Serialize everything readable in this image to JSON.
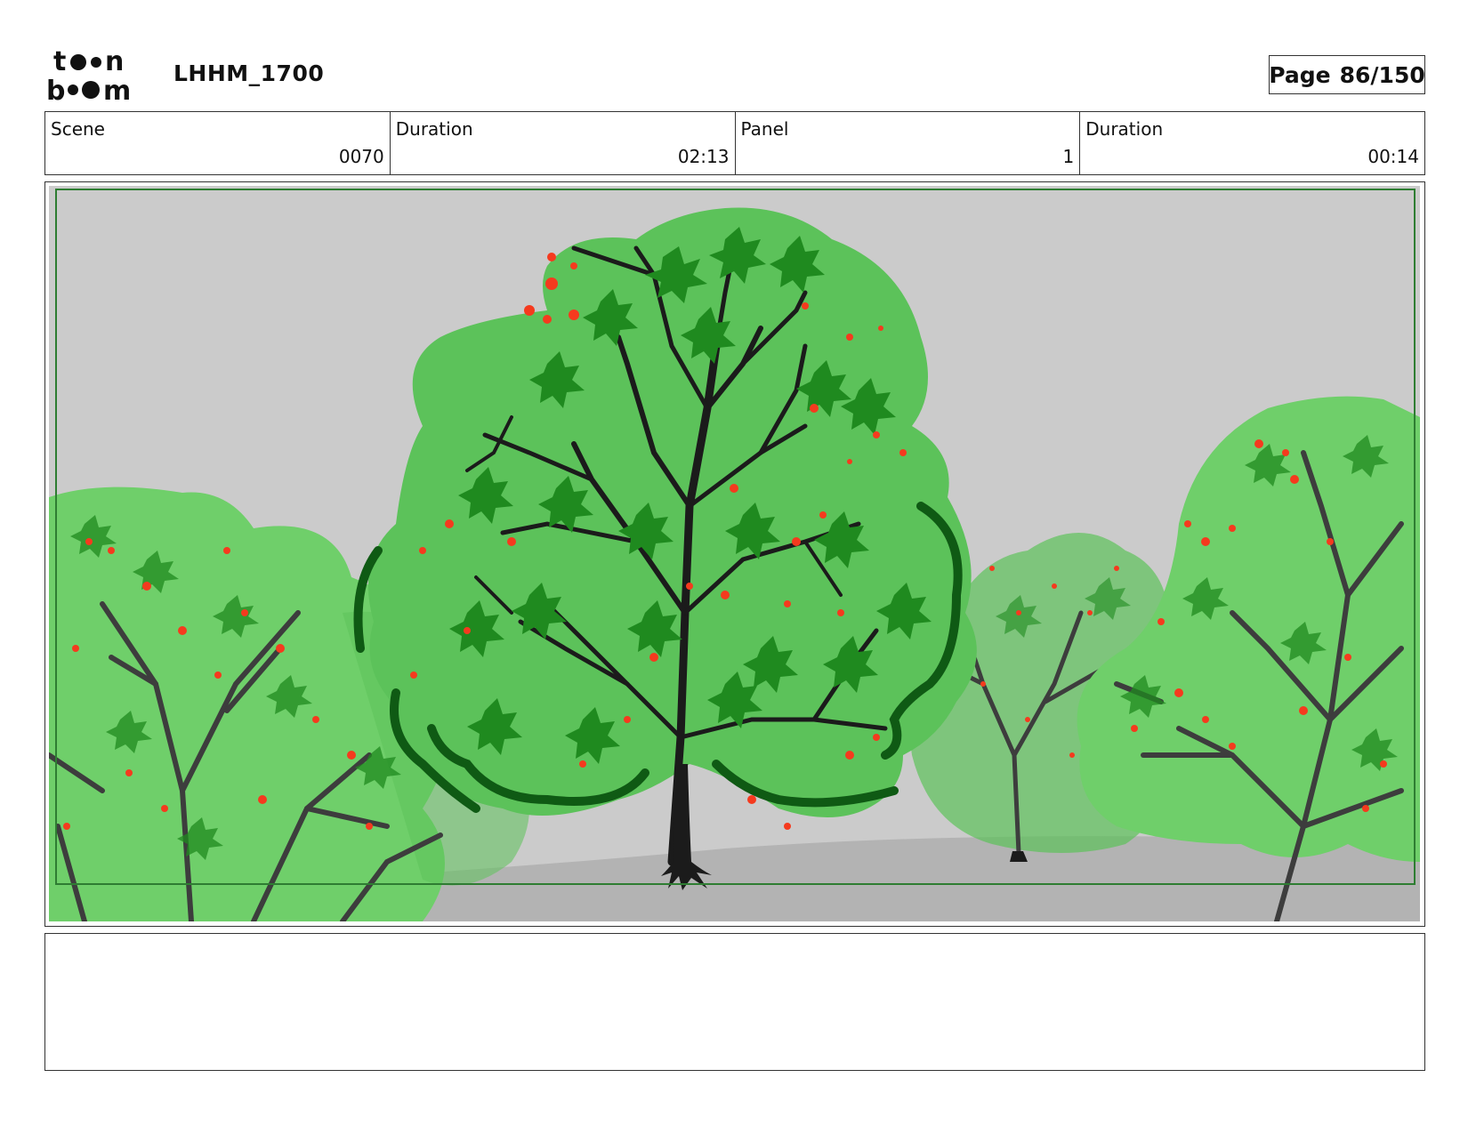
{
  "header": {
    "logo_text": "toonboom",
    "project_title": "LHHM_1700",
    "page_label": "Page",
    "page_number": "86/150"
  },
  "info": [
    {
      "label": "Scene",
      "value": "0070"
    },
    {
      "label": "Duration",
      "value": "02:13"
    },
    {
      "label": "Panel",
      "value": "1"
    },
    {
      "label": "Duration",
      "value": "00:14"
    }
  ],
  "panel": {
    "scene_description": "",
    "colors": {
      "sky": "#cbcbcb",
      "ground": "#b3b3b3",
      "foliage_light": "#6fcf6a",
      "foliage_mid": "#5cc25a",
      "leaf_dark": "#1f8a1f",
      "outline_dark": "#0f5a14",
      "trunk": "#1b1b1b",
      "branch_bg": "#3d3d3d",
      "fruit": "#f53a1e",
      "safe_frame": "#2e7d32"
    }
  },
  "notes": {
    "text": ""
  }
}
